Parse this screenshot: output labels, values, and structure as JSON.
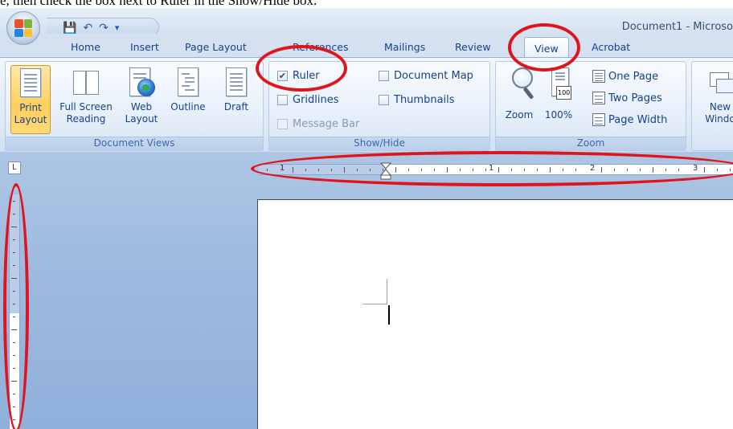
{
  "caption": "e, then check the box next to Ruler in the Show/Hide box.",
  "window": {
    "title": "Document1 - Microso"
  },
  "quick_access": {
    "save": "💾",
    "undo": "↶",
    "redo": "↷",
    "customize": "▾"
  },
  "tabs": [
    {
      "label": "Home"
    },
    {
      "label": "Insert"
    },
    {
      "label": "Page Layout"
    },
    {
      "label": "References"
    },
    {
      "label": "Mailings"
    },
    {
      "label": "Review"
    },
    {
      "label": "View"
    },
    {
      "label": "Acrobat"
    }
  ],
  "document_views": {
    "label": "Document Views",
    "print_layout": {
      "line1": "Print",
      "line2": "Layout"
    },
    "full_screen_reading": {
      "line1": "Full Screen",
      "line2": "Reading"
    },
    "web_layout": {
      "line1": "Web",
      "line2": "Layout"
    },
    "outline": {
      "line1": "Outline"
    },
    "draft": {
      "line1": "Draft"
    }
  },
  "show_hide": {
    "label": "Show/Hide",
    "ruler": {
      "label": "Ruler",
      "checked": true
    },
    "gridlines": {
      "label": "Gridlines",
      "checked": false
    },
    "message_bar": {
      "label": "Message Bar",
      "checked": false
    },
    "document_map": {
      "label": "Document Map",
      "checked": false
    },
    "thumbnails": {
      "label": "Thumbnails",
      "checked": false
    }
  },
  "zoom": {
    "label": "Zoom",
    "zoom_btn": "Zoom",
    "hundred": "100%",
    "hundred_badge": "100",
    "one_page": "One Page",
    "two_pages": "Two Pages",
    "page_width": "Page Width"
  },
  "window_group": {
    "new_window_line1": "New",
    "new_window_line2": "Windo"
  },
  "ruler": {
    "corner_symbol": "L",
    "labels": {
      "left1": "1",
      "n1": "1",
      "n2": "2",
      "n3": "3"
    }
  },
  "colors": {
    "highlight": "#e0141c",
    "accent": "#15428b",
    "selected": "#ffcf5c"
  }
}
